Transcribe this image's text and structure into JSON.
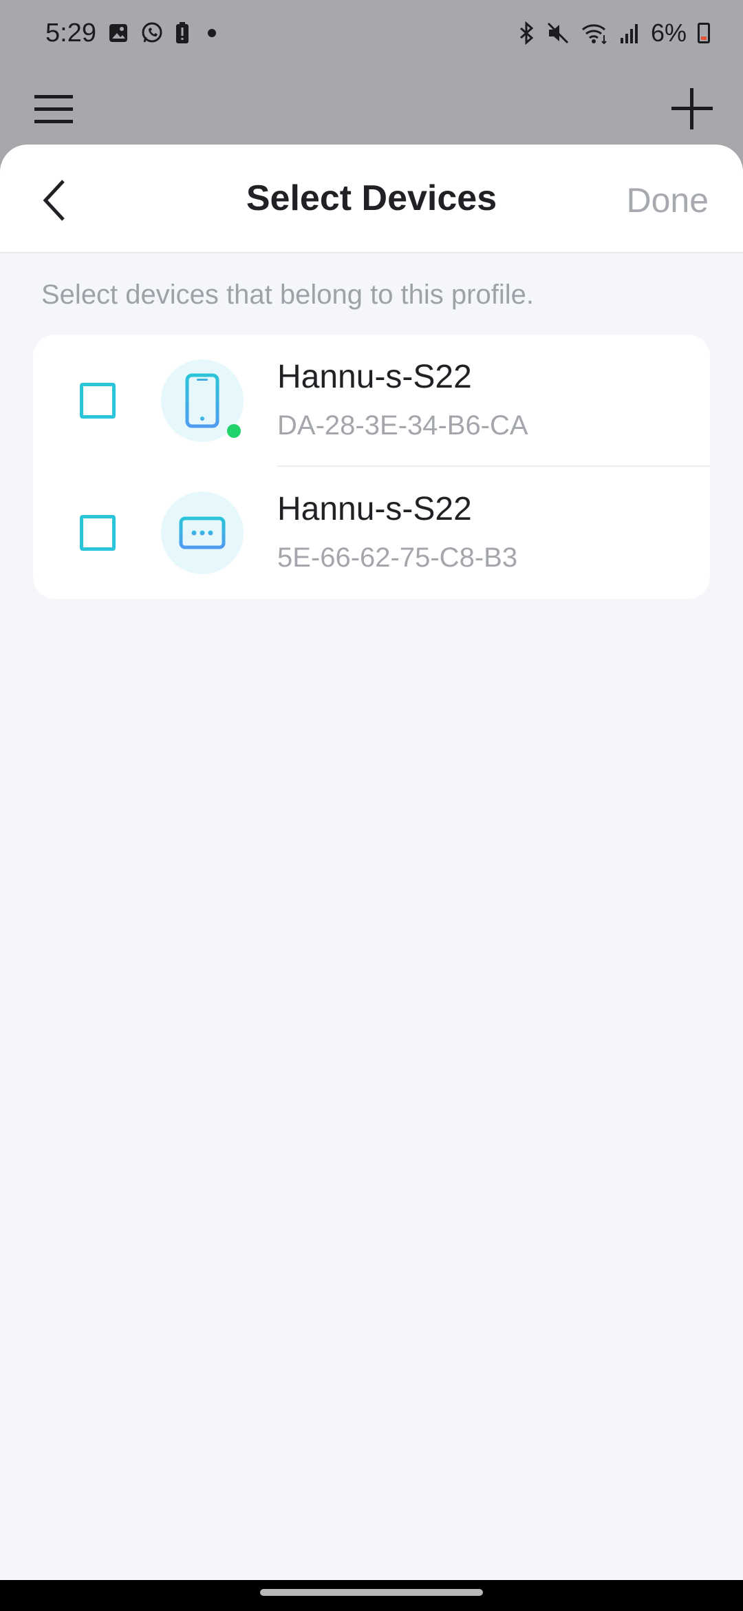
{
  "status_bar": {
    "time": "5:29",
    "battery_percent": "6%",
    "icons": [
      "image-icon",
      "whatsapp-icon",
      "battery-alert-icon",
      "dot-icon",
      "bluetooth-icon",
      "mute-icon",
      "wifi-icon",
      "signal-icon",
      "battery-icon"
    ]
  },
  "app_bar": {
    "menu_icon": "menu-icon",
    "add_icon": "plus-icon"
  },
  "sheet": {
    "title": "Select Devices",
    "done_label": "Done",
    "hint": "Select devices that belong to this profile.",
    "devices": [
      {
        "name": "Hannu-s-S22",
        "mac": "DA-28-3E-34-B6-CA",
        "icon": "phone-icon",
        "online": true,
        "checked": false
      },
      {
        "name": "Hannu-s-S22",
        "mac": "5E-66-62-75-C8-B3",
        "icon": "generic-device-icon",
        "online": false,
        "checked": false
      }
    ]
  },
  "colors": {
    "accent": "#2bc4d8",
    "online": "#22d36b",
    "done_disabled": "#a6a9ae"
  }
}
